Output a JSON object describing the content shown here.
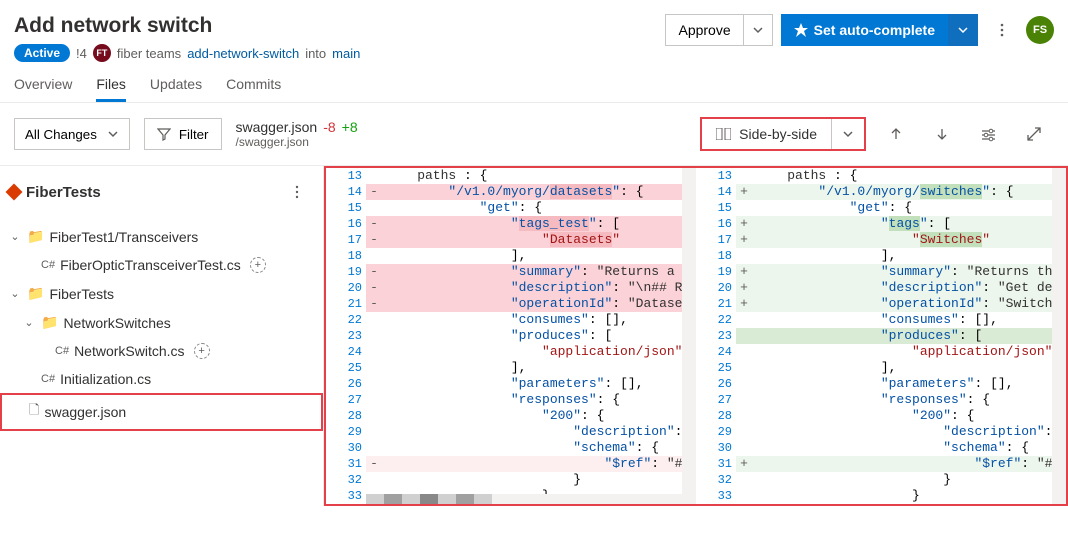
{
  "title": "Add network switch",
  "status": "Active",
  "pr_number": "!4",
  "avatar_initials": "FT",
  "team_name": "fiber teams",
  "branch_source": "add-network-switch",
  "branch_sep": "into",
  "branch_target": "main",
  "user_avatar": "FS",
  "actions": {
    "approve": "Approve",
    "autocomplete": "Set auto-complete"
  },
  "tabs": [
    "Overview",
    "Files",
    "Updates",
    "Commits"
  ],
  "active_tab": 1,
  "toolbar": {
    "changes": "All Changes",
    "filter": "Filter",
    "filename": "swagger.json",
    "deletions": "-8",
    "additions": "+8",
    "filepath": "/swagger.json",
    "view_mode": "Side-by-side"
  },
  "sidebar": {
    "root": "FiberTests",
    "tree": [
      {
        "type": "folder",
        "label": "FiberTest1/Transceivers",
        "indent": 0,
        "expanded": true
      },
      {
        "type": "cs",
        "label": "FiberOpticTransceiverTest.cs",
        "indent": 1,
        "addable": true
      },
      {
        "type": "folder",
        "label": "FiberTests",
        "indent": 0,
        "expanded": true
      },
      {
        "type": "folder",
        "label": "NetworkSwitches",
        "indent": 1,
        "expanded": true
      },
      {
        "type": "cs",
        "label": "NetworkSwitch.cs",
        "indent": 2,
        "addable": true
      },
      {
        "type": "cs",
        "label": "Initialization.cs",
        "indent": 1
      },
      {
        "type": "file",
        "label": "swagger.json",
        "indent": 0,
        "selected": true
      }
    ]
  },
  "diff": {
    "left": [
      {
        "n": 13,
        "m": "",
        "text": "    paths : {"
      },
      {
        "n": 14,
        "m": "-",
        "cls": "del-strong",
        "text": "        \"/v1.0/myorg/datasets\": {",
        "hl": "datasets"
      },
      {
        "n": 15,
        "m": "",
        "text": "            \"get\": {"
      },
      {
        "n": 16,
        "m": "-",
        "cls": "del-strong",
        "text": "                \"tags_test\": [",
        "hl": "tags_test"
      },
      {
        "n": 17,
        "m": "-",
        "cls": "del-strong",
        "text": "                    \"Datasets\"",
        "hl": "Datasets"
      },
      {
        "n": 18,
        "m": "",
        "text": "                ],"
      },
      {
        "n": 19,
        "m": "-",
        "cls": "del-strong",
        "text": "                \"summary\": \"Returns a list of"
      },
      {
        "n": 20,
        "m": "-",
        "cls": "del-strong",
        "text": "                \"description\": \"\\n## Required"
      },
      {
        "n": 21,
        "m": "-",
        "cls": "del-strong",
        "text": "                \"operationId\": \"Datasets_GetDa"
      },
      {
        "n": 22,
        "m": "",
        "text": "                \"consumes\": [],"
      },
      {
        "n": 23,
        "m": "",
        "text": "                \"produces\": ["
      },
      {
        "n": 24,
        "m": "",
        "text": "                    \"application/json\""
      },
      {
        "n": 25,
        "m": "",
        "text": "                ],"
      },
      {
        "n": 26,
        "m": "",
        "text": "                \"parameters\": [],"
      },
      {
        "n": 27,
        "m": "",
        "text": "                \"responses\": {"
      },
      {
        "n": 28,
        "m": "",
        "text": "                    \"200\": {"
      },
      {
        "n": 29,
        "m": "",
        "text": "                        \"description\": \"OK\","
      },
      {
        "n": 30,
        "m": "",
        "text": "                        \"schema\": {"
      },
      {
        "n": 31,
        "m": "-",
        "cls": "del-line",
        "text": "                            \"$ref\": \"#/definit"
      },
      {
        "n": 32,
        "m": "",
        "text": "                        }"
      },
      {
        "n": 33,
        "m": "",
        "text": "                    }"
      }
    ],
    "right": [
      {
        "n": 13,
        "m": "",
        "text": "    paths : {"
      },
      {
        "n": 14,
        "m": "+",
        "cls": "add-line",
        "text": "        \"/v1.0/myorg/switches\": {",
        "hl": "switches"
      },
      {
        "n": 15,
        "m": "",
        "text": "            \"get\": {"
      },
      {
        "n": 16,
        "m": "+",
        "cls": "add-line",
        "text": "                \"tags\": [",
        "hl": "tags"
      },
      {
        "n": 17,
        "m": "+",
        "cls": "add-line",
        "text": "                    \"Switches\"",
        "hl": "Switches"
      },
      {
        "n": 18,
        "m": "",
        "text": "                ],"
      },
      {
        "n": 19,
        "m": "+",
        "cls": "add-line",
        "text": "                \"summary\": \"Returns the select"
      },
      {
        "n": 20,
        "m": "+",
        "cls": "add-line",
        "text": "                \"description\": \"Get detailed s"
      },
      {
        "n": 21,
        "m": "+",
        "cls": "add-line",
        "text": "                \"operationId\": \"Switches_GetSw"
      },
      {
        "n": 22,
        "m": "",
        "text": "                \"consumes\": [],"
      },
      {
        "n": 23,
        "m": "",
        "cls": "add-strong",
        "text": "                \"produces\": ["
      },
      {
        "n": 24,
        "m": "",
        "text": "                    \"application/json\""
      },
      {
        "n": 25,
        "m": "",
        "text": "                ],"
      },
      {
        "n": 26,
        "m": "",
        "text": "                \"parameters\": [],"
      },
      {
        "n": 27,
        "m": "",
        "text": "                \"responses\": {"
      },
      {
        "n": 28,
        "m": "",
        "text": "                    \"200\": {"
      },
      {
        "n": 29,
        "m": "",
        "text": "                        \"description\": \"OK\","
      },
      {
        "n": 30,
        "m": "",
        "text": "                        \"schema\": {"
      },
      {
        "n": 31,
        "m": "+",
        "cls": "add-line",
        "text": "                            \"$ref\": \"#/definit"
      },
      {
        "n": 32,
        "m": "",
        "text": "                        }"
      },
      {
        "n": 33,
        "m": "",
        "text": "                    }"
      }
    ]
  }
}
